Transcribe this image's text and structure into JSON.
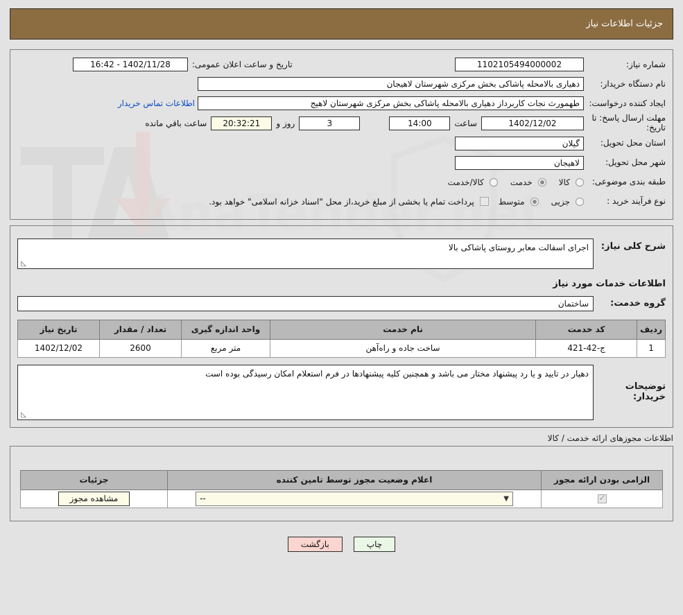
{
  "header": {
    "title": "جزئیات اطلاعات نیاز"
  },
  "info": {
    "need_no_label": "شماره نیاز:",
    "need_no_value": "1102105494000002",
    "public_announce_label": "تاریخ و ساعت اعلان عمومی:",
    "public_announce_value": "1402/11/28 - 16:42",
    "buyer_label": "نام دستگاه خریدار:",
    "buyer_value": "دهیاری بالامحله پاشاکی بخش مرکزی  شهرستان لاهیجان",
    "creator_label": "ایجاد کننده درخواست:",
    "creator_value": "طهمورث نجات کاربرداز  دهیاری بالامحله پاشاکی بخش مرکزی  شهرستان لاهیج",
    "contact_link": "اطلاعات تماس خریدار",
    "deadline_label": "مهلت ارسال پاسخ: تا تاریخ:",
    "deadline_date": "1402/12/02",
    "hour_label": "ساعت",
    "deadline_time": "14:00",
    "remaining_days": "3",
    "days_and_label": "روز و",
    "remaining_timer": "20:32:21",
    "remaining_suffix": "ساعت باقي مانده",
    "province_label": "استان محل تحویل:",
    "province_value": "گیلان",
    "city_label": "شهر محل تحویل:",
    "city_value": "لاهیجان",
    "category_label": "طبقه بندی موضوعی:",
    "category_options": [
      {
        "label": "کالا",
        "selected": false
      },
      {
        "label": "خدمت",
        "selected": true
      },
      {
        "label": "کالا/خدمت",
        "selected": false
      }
    ],
    "process_label": "نوع فرآیند خرید :",
    "process_options": [
      {
        "label": "جزیی",
        "selected": false
      },
      {
        "label": "متوسط",
        "selected": true
      }
    ],
    "payment_note": "پرداخت تمام یا بخشی از مبلغ خرید،از محل \"اسناد خزانه اسلامی\" خواهد بود."
  },
  "description": {
    "label": "شرح کلی نیاز:",
    "value": "اجرای اسفالت معابر روستای پاشاکی بالا"
  },
  "services": {
    "section_title": "اطلاعات خدمات مورد نیاز",
    "group_label": "گروه خدمت:",
    "group_value": "ساختمان",
    "columns": [
      "ردیف",
      "کد خدمت",
      "نام خدمت",
      "واحد اندازه گیری",
      "تعداد / مقدار",
      "تاریخ نیاز"
    ],
    "rows": [
      {
        "index": "1",
        "code": "ج-42-421",
        "name": "ساخت جاده و راه‌آهن",
        "unit": "متر مربع",
        "quantity": "2600",
        "need_date": "1402/12/02"
      }
    ]
  },
  "buyer_notes": {
    "label": "توضیحات خریدار:",
    "value": "دهیار در تایید و یا رد پیشنهاد مختار می باشد و همچنین کلیه پیشنهادها در فرم استعلام امکان رسیدگی بوده است"
  },
  "permits": {
    "caption": "اطلاعات مجوزهای ارائه خدمت / کالا",
    "columns": [
      "الزامی بودن ارائه مجوز",
      "اعلام وضعیت مجوز توسط تامین کننده",
      "جزئیات"
    ],
    "rows": [
      {
        "required_checked": true,
        "status_value": "--",
        "details_button": "مشاهده مجوز"
      }
    ]
  },
  "footer": {
    "print_label": "چاپ",
    "back_label": "بازگشت"
  },
  "watermark": {
    "text": "AnaTender.net"
  }
}
